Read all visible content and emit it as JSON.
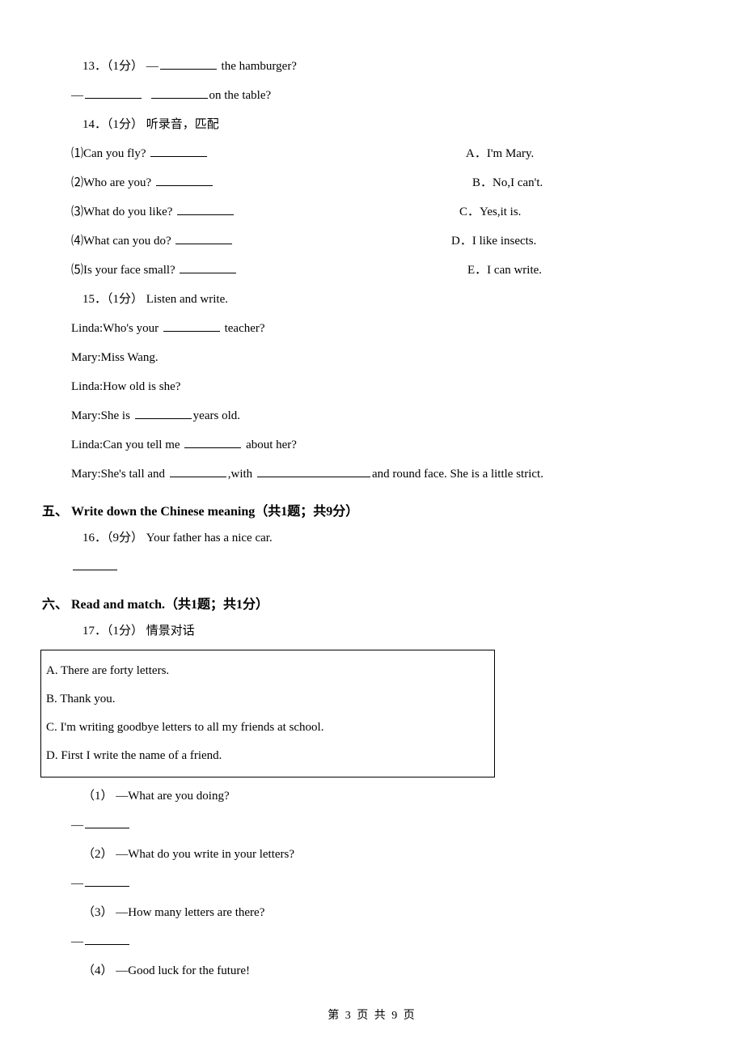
{
  "q13": {
    "num": "13．",
    "points": "（1分）",
    "line1_prefix": "—",
    "line1_suffix": " the hamburger?",
    "line2_prefix": "—",
    "line2_suffix": "on the table?"
  },
  "q14": {
    "num": "14．",
    "points": "（1分）",
    "title": " 听录音，匹配",
    "items": [
      {
        "q": "⑴Can you fly?",
        "opt": "A．I'm Mary."
      },
      {
        "q": "⑵Who are you?",
        "opt": "B．No,I can't."
      },
      {
        "q": "⑶What do you like?",
        "opt": "C．Yes,it is."
      },
      {
        "q": "⑷What can you do?",
        "opt": "D．I like insects."
      },
      {
        "q": "⑸Is your face small?",
        "opt": "E．I can write."
      }
    ]
  },
  "q15": {
    "num": "15．",
    "points": "（1分）",
    "title": " Listen and write.",
    "l1a": "Linda:Who's your ",
    "l1b": " teacher?",
    "l2": "Mary:Miss Wang.",
    "l3": "Linda:How old is she?",
    "l4a": "Mary:She is ",
    "l4b": "years old.",
    "l5a": "Linda:Can you tell me ",
    "l5b": " about her?",
    "l6a": "Mary:She's tall and ",
    "l6b": ",with ",
    "l6c": "and round face. She is a little strict."
  },
  "sec5": "五、 Write down the Chinese meaning（共1题；共9分）",
  "q16": {
    "num": "16．",
    "points": "（9分）",
    "text": " Your father has a nice car."
  },
  "sec6": "六、 Read and match.（共1题；共1分）",
  "q17": {
    "num": "17．",
    "points": "（1分）",
    "title": " 情景对话",
    "box": [
      "A. There are forty letters.",
      "B. Thank you.",
      "C. I'm writing goodbye letters to all my friends at school.",
      "D. First I write the name of a friend."
    ],
    "sub": [
      {
        "n": "（1）",
        "q": "—What are you doing?"
      },
      {
        "n": "（2）",
        "q": "—What do you write in your letters?"
      },
      {
        "n": "（3）",
        "q": "—How many letters are there?"
      },
      {
        "n": "（4）",
        "q": "—Good luck for the future!"
      }
    ],
    "dash": "—"
  },
  "footer": "第 3 页 共 9 页"
}
